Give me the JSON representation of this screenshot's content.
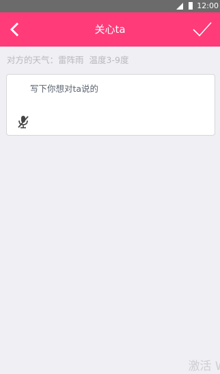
{
  "status_bar": {
    "time": "12:00",
    "signal_icon": "signal-icon",
    "battery_icon": "battery-icon"
  },
  "header": {
    "title": "关心ta",
    "back_icon": "chevron-left-icon",
    "confirm_icon": "check-icon",
    "background_color": "#ff3b7a"
  },
  "weather": {
    "label": "对方的天气：",
    "condition": "雷阵雨",
    "temperature": "温度3-9度"
  },
  "message": {
    "placeholder": "写下你想对ta说的",
    "value": "",
    "mic_icon": "microphone-muted-icon"
  },
  "watermark": {
    "text": "激活 Wi"
  }
}
